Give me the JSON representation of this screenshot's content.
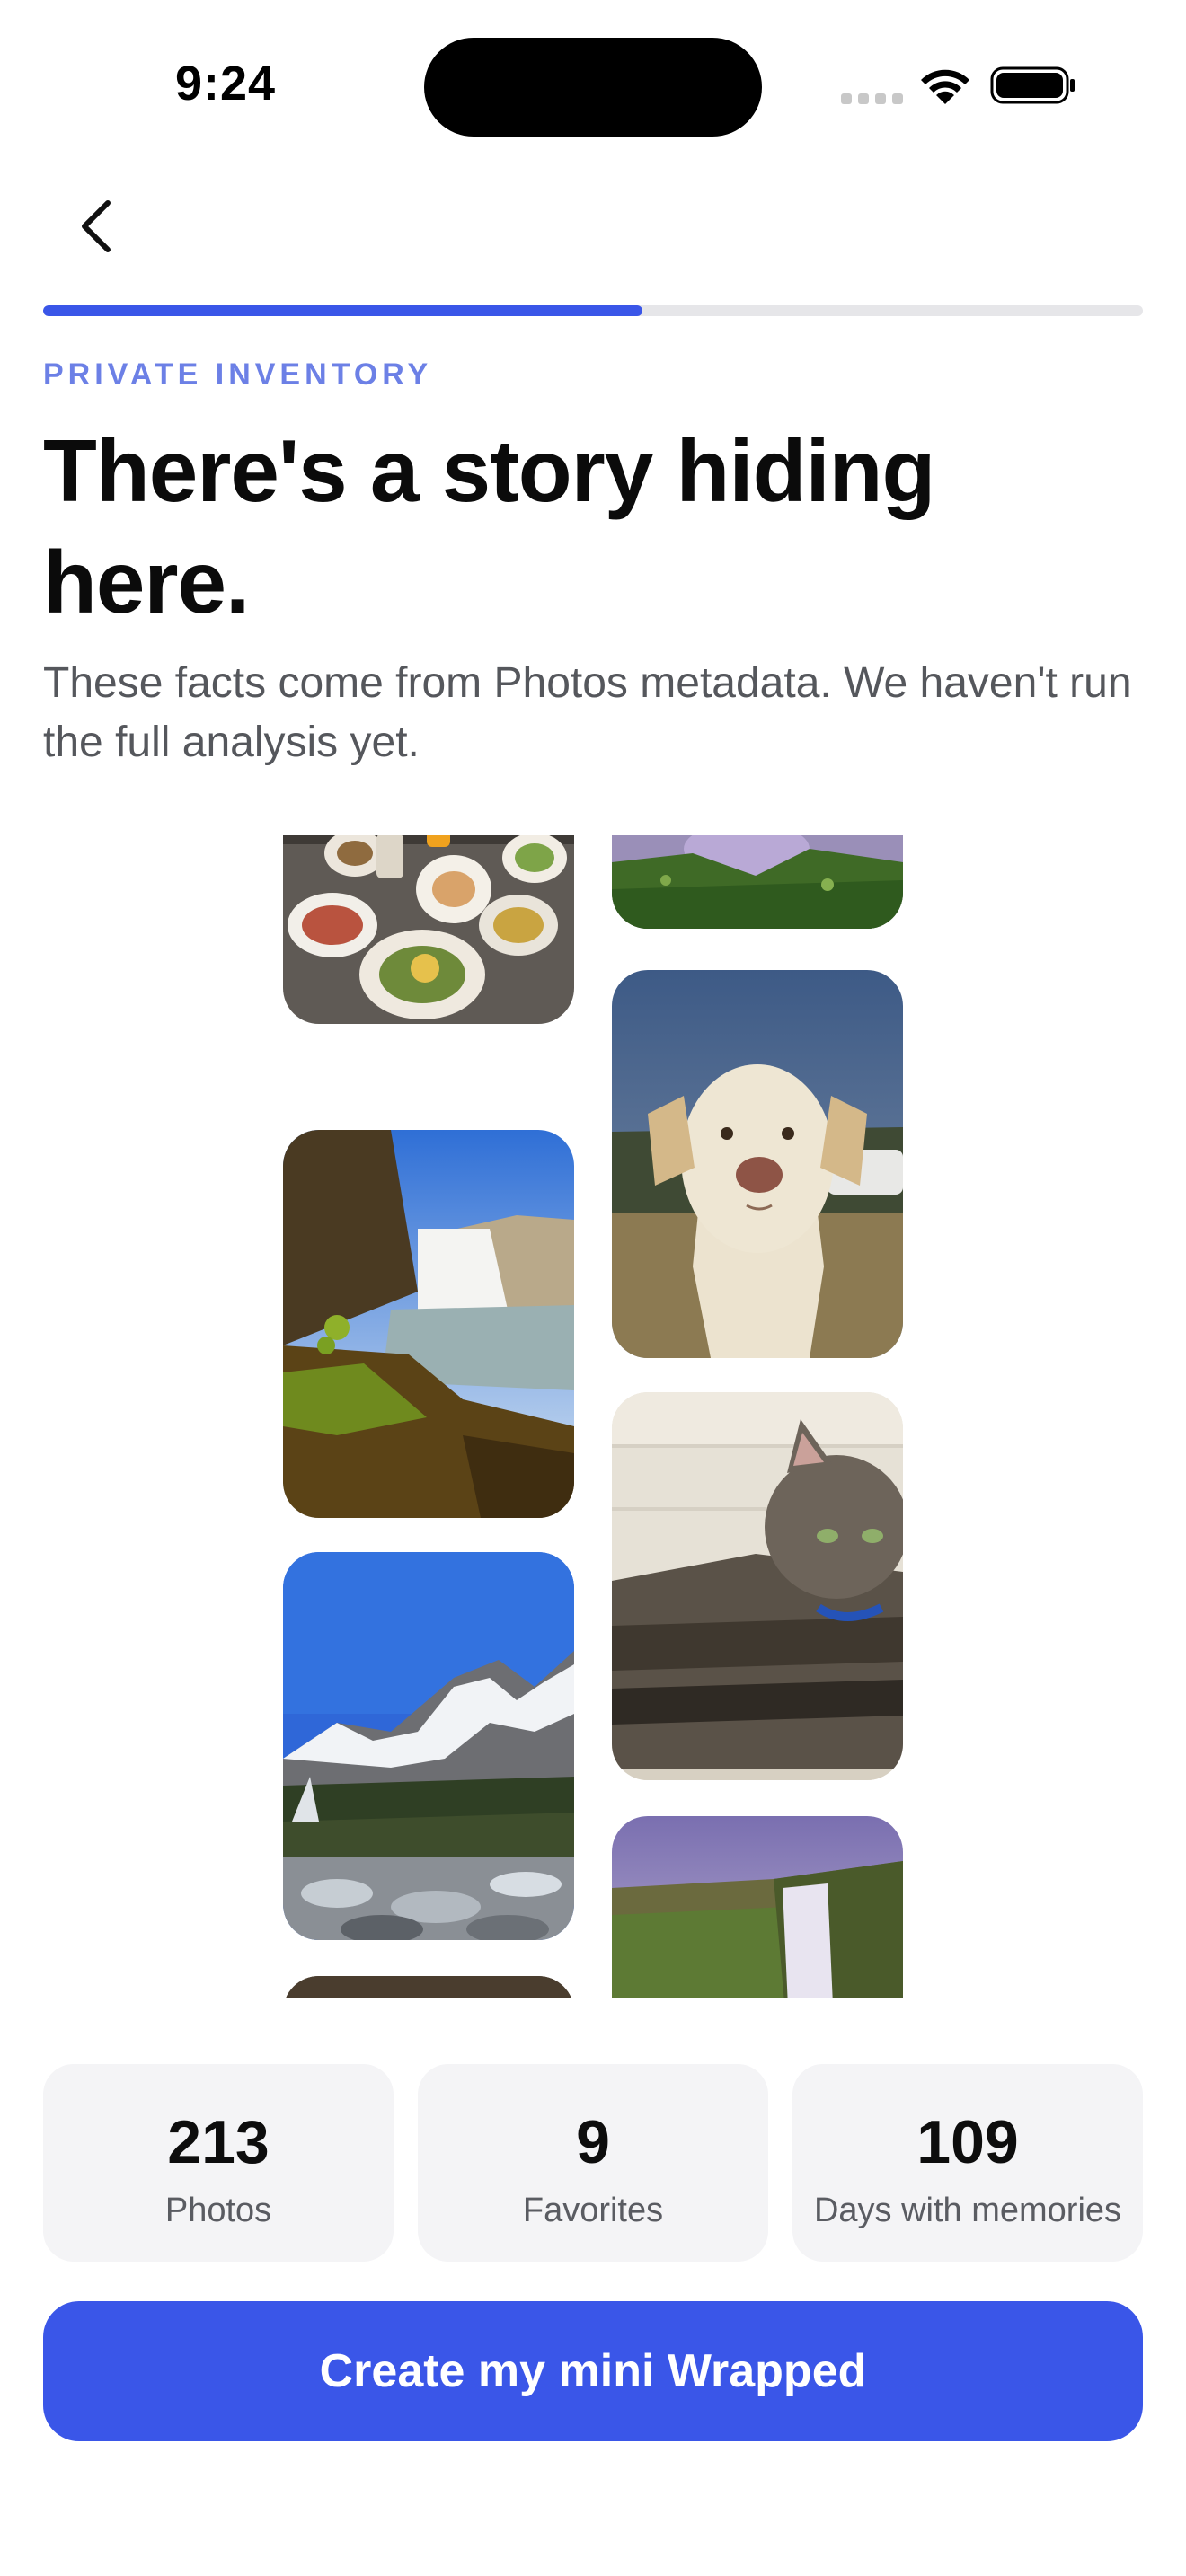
{
  "status_bar": {
    "time": "9:24"
  },
  "nav": {
    "back_icon": "chevron-left-icon"
  },
  "progress": {
    "fraction": 0.545
  },
  "header": {
    "eyebrow": "PRIVATE INVENTORY",
    "title": "There's a story hiding here.",
    "subtitle": "These facts come from Photos metadata. We haven't run the full analysis yet."
  },
  "collage": {
    "photos": [
      "food-photo",
      "waterfall-photo",
      "mountain-photo",
      "meadow-photo",
      "dog-photo",
      "cat-photo",
      "falls-photo"
    ]
  },
  "stats": [
    {
      "value": "213",
      "label": "Photos"
    },
    {
      "value": "9",
      "label": "Favorites"
    },
    {
      "value": "109",
      "label": "Days with memories"
    }
  ],
  "cta": {
    "label": "Create my mini Wrapped"
  },
  "colors": {
    "accent": "#3a56e8",
    "eyebrow": "#6c80e6",
    "card_bg": "#f4f4f6"
  }
}
